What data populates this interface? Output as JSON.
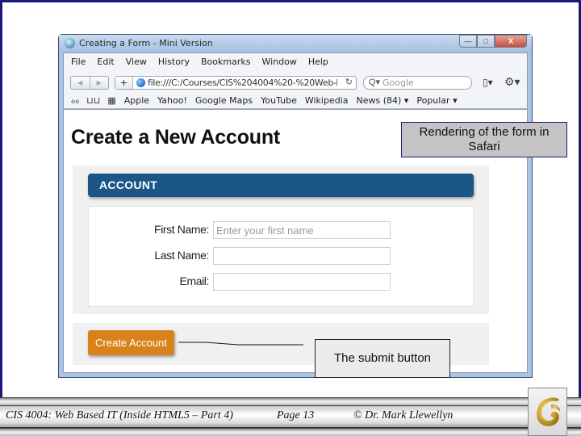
{
  "browser": {
    "window_title": "Creating a Form - Mini Version",
    "window_buttons": {
      "minimize": "—",
      "maximize": "□",
      "close": "X"
    },
    "menu": [
      "File",
      "Edit",
      "View",
      "History",
      "Bookmarks",
      "Window",
      "Help"
    ],
    "nav": {
      "back": "◀",
      "forward": "▶",
      "add": "+"
    },
    "address": "file:///C:/Courses/CIS%204004%20-%20Web-Based%",
    "reload": "↻",
    "search_placeholder": "Google",
    "search_icon": "Q▾",
    "page_menu_icon": "▯▾",
    "gear_menu_icon": "⚙▾",
    "bookmarks_icons": {
      "reading_list": "ℴℴ",
      "bookmarks": "⊔⊔",
      "top_sites": "▦"
    },
    "bookmarks": [
      "Apple",
      "Yahoo!",
      "Google Maps",
      "YouTube",
      "Wikipedia",
      "News (84) ▾",
      "Popular ▾"
    ]
  },
  "page": {
    "title": "Create a New Account",
    "section_header": "ACCOUNT",
    "fields": [
      {
        "label": "First Name:",
        "value": "",
        "placeholder": "Enter your first name"
      },
      {
        "label": "Last Name:",
        "value": "",
        "placeholder": ""
      },
      {
        "label": "Email:",
        "value": "",
        "placeholder": ""
      }
    ],
    "submit_label": "Create Account"
  },
  "callouts": {
    "safari": "Rendering of the form in Safari",
    "submit": "The submit button"
  },
  "footer": {
    "course": "CIS 4004: Web Based IT (Inside HTML5 – Part 4)",
    "page": "Page 13",
    "copyright": "© Dr. Mark Llewellyn"
  },
  "colors": {
    "slide_border": "#1a1a7a",
    "header_blue": "#1b5686",
    "button_orange": "#d9821b",
    "logo_gold": "#c9a227"
  }
}
